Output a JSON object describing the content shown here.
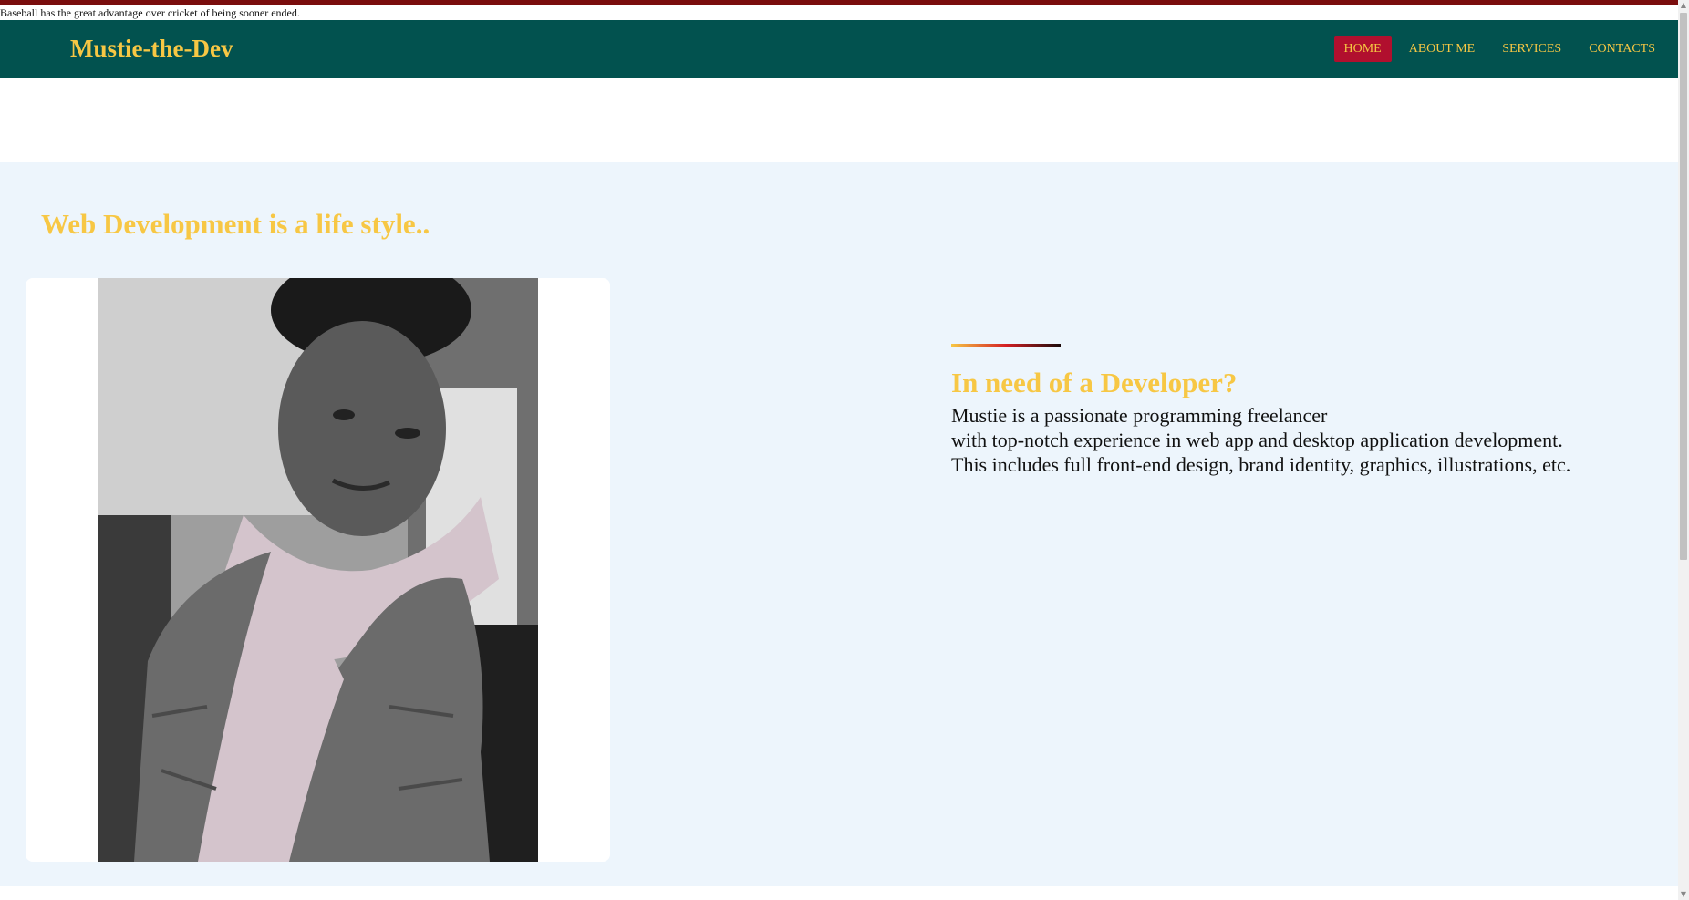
{
  "quote_bar": {
    "text": "Baseball has the great advantage over cricket of being sooner ended."
  },
  "navbar": {
    "brand": "Mustie-the-Dev",
    "links": [
      {
        "label": "HOME",
        "active": true
      },
      {
        "label": "ABOUT ME",
        "active": false
      },
      {
        "label": "SERVICES",
        "active": false
      },
      {
        "label": "CONTACTS",
        "active": false
      }
    ]
  },
  "hero": {
    "tagline": "Web Development is a life style..",
    "intro": {
      "heading": "In need of a Developer?",
      "lines": [
        "Mustie is a passionate programming freelancer",
        "with top-notch experience in web app and desktop application development.",
        "This includes full front-end design, brand identity, graphics, illustrations, etc."
      ]
    }
  },
  "colors": {
    "top_strip": "#7a0d0d",
    "navbar_bg": "#02524f",
    "brand_yellow": "#f7c744",
    "active_nav_bg": "#b10f2e",
    "hero_bg": "#edf5fc"
  },
  "icons": {
    "scroll_up": "triangle-up-icon",
    "scroll_down": "triangle-down-icon"
  }
}
